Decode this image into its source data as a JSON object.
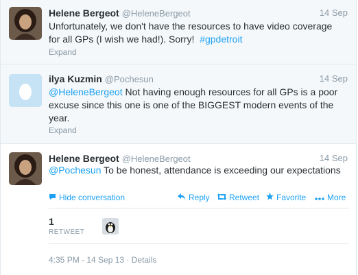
{
  "tweets": [
    {
      "name": "Helene Bergeot",
      "handle": "@HeleneBergeot",
      "time": "14 Sep",
      "text": "Unfortunately, we don't have the resources to have video coverage for all GPs (I wish we had!). Sorry!",
      "hashtag": "#gpdetroit",
      "expand": "Expand"
    },
    {
      "name": "ilya Kuzmin",
      "handle": "@Pochesun",
      "time": "14 Sep",
      "mention": "@HeleneBergeot",
      "text": "Not having enough resources for all GPs is a poor excuse since this one is one of the BIGGEST modern events of the year.",
      "expand": "Expand"
    },
    {
      "name": "Helene Bergeot",
      "handle": "@HeleneBergeot",
      "time": "14 Sep",
      "mention": "@Pochesun",
      "text": "To be honest, attendance is exceeding our expectations",
      "actions": {
        "hide": "Hide conversation",
        "reply": "Reply",
        "retweet": "Retweet",
        "favorite": "Favorite",
        "more": "More"
      },
      "retweet_count": "1",
      "retweet_label": "RETWEET",
      "timestamp": "4:35 PM - 14 Sep 13",
      "details": "Details"
    }
  ],
  "colors": {
    "link": "#1da1f2",
    "muted": "#8899a6",
    "bg_collapsed": "#f5f8fa"
  },
  "icons": [
    "speech-bubble-icon",
    "reply-arrow-icon",
    "retweet-icon",
    "star-icon",
    "more-dots-icon",
    "egg-avatar-icon"
  ]
}
